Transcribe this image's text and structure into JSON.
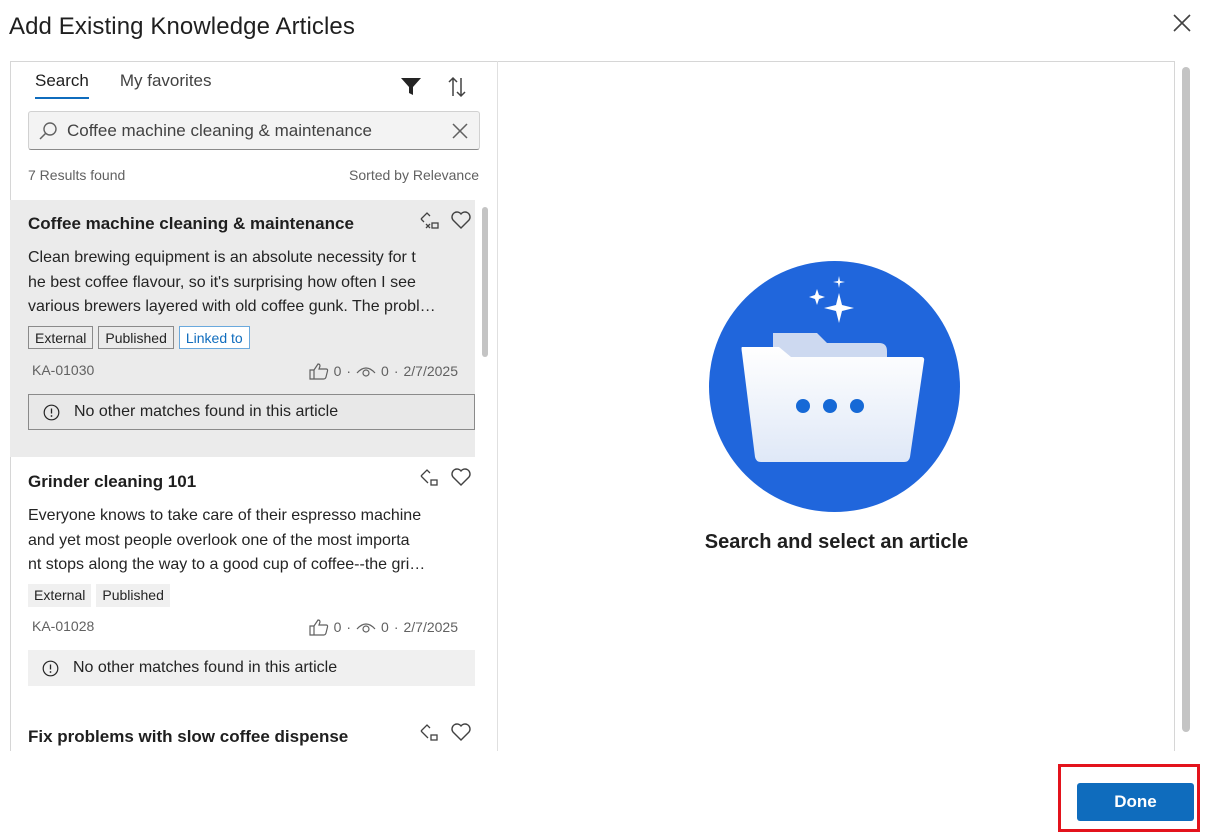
{
  "dialog": {
    "title": "Add Existing Knowledge Articles"
  },
  "tabs": [
    {
      "label": "Search",
      "active": true
    },
    {
      "label": "My favorites",
      "active": false
    }
  ],
  "search": {
    "value": "Coffee machine cleaning & maintenance",
    "placeholder": ""
  },
  "results": {
    "count_text": "7 Results found",
    "sort_text": "Sorted by Relevance",
    "items": [
      {
        "title": "Coffee machine cleaning & maintenance",
        "desc_lines": [
          "Clean brewing equipment is an absolute necessity for t",
          "he best coffee flavour, so it's surprising how often I see",
          "various brewers layered with old coffee gunk. The probl…"
        ],
        "tags": [
          "External",
          "Published",
          "Linked to"
        ],
        "id": "KA-01030",
        "likes": "0",
        "views": "0",
        "date": "2/7/2025",
        "notice": "No other matches found in this article",
        "selected": true
      },
      {
        "title": "Grinder cleaning 101",
        "desc_lines": [
          "Everyone knows to take care of their espresso machine",
          "and yet most people overlook one of the most importa",
          "nt stops along the way to a good cup of coffee--the gri…"
        ],
        "tags": [
          "External",
          "Published"
        ],
        "id": "KA-01028",
        "likes": "0",
        "views": "0",
        "date": "2/7/2025",
        "notice": "No other matches found in this article",
        "selected": false
      },
      {
        "title": "Fix problems with slow coffee dispense"
      }
    ]
  },
  "empty_state": {
    "text": "Search and select an article"
  },
  "footer": {
    "done_label": "Done"
  },
  "colors": {
    "accent": "#0f6cbd",
    "highlight": "#e3131c",
    "illustration_blue": "#2066dc"
  },
  "icons": [
    "close-icon",
    "filter-icon",
    "sort-icon",
    "search-icon",
    "clear-icon",
    "unlink-icon",
    "link-icon",
    "heart-icon",
    "thumbs-up-icon",
    "eye-icon",
    "info-icon",
    "folder-illustration",
    "sparkle-icon"
  ]
}
